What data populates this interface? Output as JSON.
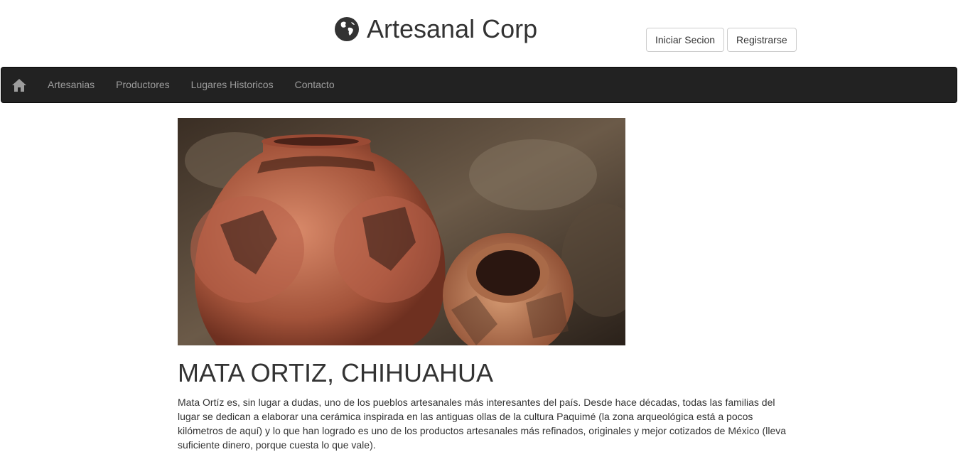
{
  "header": {
    "brand": "Artesanal Corp",
    "login_label": "Iniciar Secion",
    "register_label": "Registrarse"
  },
  "nav": {
    "items": [
      {
        "label": "Artesanias"
      },
      {
        "label": "Productores"
      },
      {
        "label": "Lugares Historicos"
      },
      {
        "label": "Contacto"
      }
    ]
  },
  "article": {
    "title": "MATA ORTIZ, CHIHUAHUA",
    "body": "Mata Ortíz es, sin lugar a dudas, uno de los pueblos artesanales más interesantes del país. Desde hace décadas, todas las familias del lugar se dedican a elaborar una cerámica inspirada en las antiguas ollas de la cultura Paquimé (la zona arqueológica está a pocos kilómetros de aquí) y lo que han logrado es uno de los productos artesanales más refinados, originales y mejor cotizados de México (lleva suficiente dinero, porque cuesta lo que vale)."
  },
  "colors": {
    "navbar_bg": "#222222",
    "nav_text": "#9d9d9d"
  }
}
